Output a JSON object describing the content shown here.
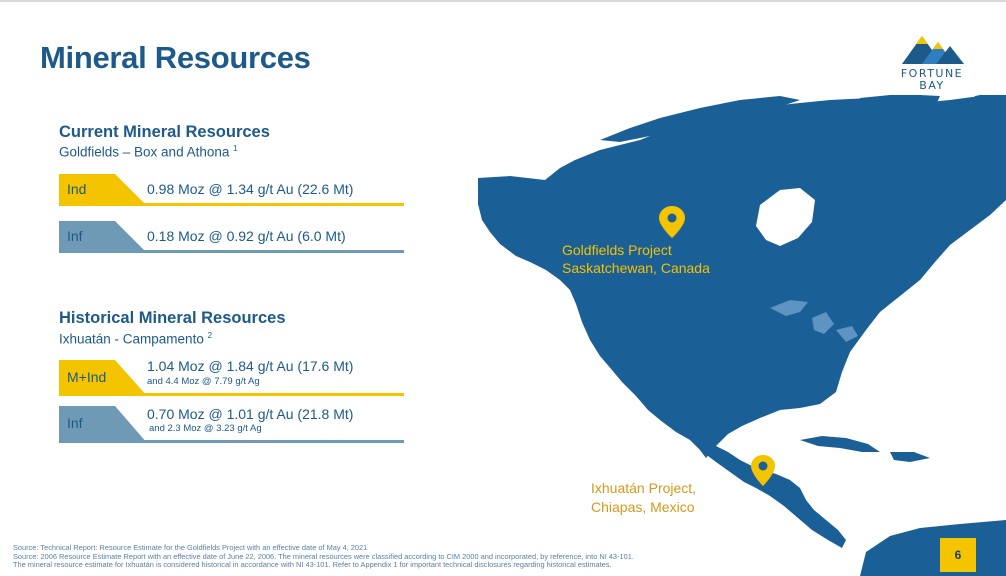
{
  "header": {
    "title": "Mineral Resources"
  },
  "logo": {
    "line1": "FORTUNE",
    "line2": "BAY"
  },
  "current": {
    "title": "Current Mineral Resources",
    "subtitle": "Goldfields – Box and Athona",
    "subtitle_sup": "1",
    "rows": [
      {
        "tag": "Ind",
        "main": "0.98 Moz @ 1.34 g/t Au (22.6 Mt)",
        "tag_color": "#f5c400",
        "line_color": "#f5c400"
      },
      {
        "tag": "Inf",
        "main": "0.18 Moz @ 0.92 g/t Au (6.0 Mt)",
        "tag_color": "#6f9ab5",
        "line_color": "#6f9ab5"
      }
    ]
  },
  "historical": {
    "title": "Historical Mineral Resources",
    "subtitle": "Ixhuatán - Campamento",
    "subtitle_sup": "2",
    "rows": [
      {
        "tag": "M+Ind",
        "main": "1.04 Moz @ 1.84 g/t Au (17.6 Mt)",
        "sub": "and 4.4 Moz @ 7.79 g/t Ag",
        "tag_color": "#f5c400",
        "line_color": "#f5c400"
      },
      {
        "tag": "Inf",
        "main": "0.70 Moz @ 1.01 g/t Au (21.8 Mt)",
        "sub": "and 2.3 Moz @ 3.23 g/t Ag",
        "tag_color": "#6f9ab5",
        "line_color": "#6f9ab5"
      }
    ]
  },
  "map": {
    "goldfields_line1": "Goldfields Project",
    "goldfields_line2": "Saskatchewan, Canada",
    "ixhuatan_line1": "Ixhuatán Project,",
    "ixhuatan_line2": "Chiapas, Mexico",
    "land_color": "#1b5f97",
    "water_color": "#ffffff",
    "pin_color": "#f5c400"
  },
  "footer": {
    "line1": "Source: Technical Report: Resource Estimate for the Goldfields Project with an effective date of May 4, 2021",
    "line2": "Source: 2006 Resource Estimate Report with an effective date of June 22, 2006. The mineral resources were classified according to CIM 2000 and incorporated, by reference, into NI 43-101.",
    "line3": "The mineral resource estimate for Ixhuatán is considered historical in accordance with NI 43-101. Refer to Appendix 1 for important technical disclosures regarding historical estimates."
  },
  "page": {
    "number": "6"
  }
}
